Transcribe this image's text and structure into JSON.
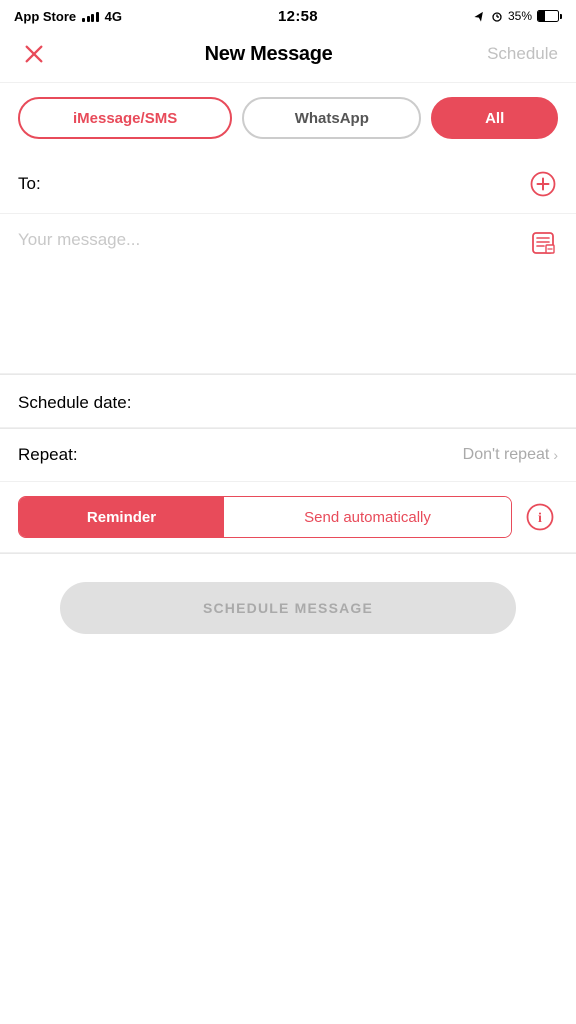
{
  "statusBar": {
    "carrier": "App Store",
    "signal": "4G",
    "time": "12:58",
    "battery": "35%",
    "batteryPercent": 35
  },
  "nav": {
    "title": "New Message",
    "scheduleLabel": "Schedule",
    "closeIcon": "close-icon"
  },
  "tabs": {
    "imessage": "iMessage/SMS",
    "whatsapp": "WhatsApp",
    "all": "All"
  },
  "toField": {
    "label": "To:",
    "addIcon": "add-circle-icon"
  },
  "messageField": {
    "placeholder": "Your message...",
    "templateIcon": "template-icon"
  },
  "scheduleDate": {
    "label": "Schedule date:"
  },
  "repeat": {
    "label": "Repeat:",
    "value": "Don't repeat"
  },
  "toggle": {
    "reminder": "Reminder",
    "sendAuto": "Send automatically",
    "infoIcon": "info-icon"
  },
  "scheduleButton": {
    "label": "SCHEDULE MESSAGE"
  }
}
